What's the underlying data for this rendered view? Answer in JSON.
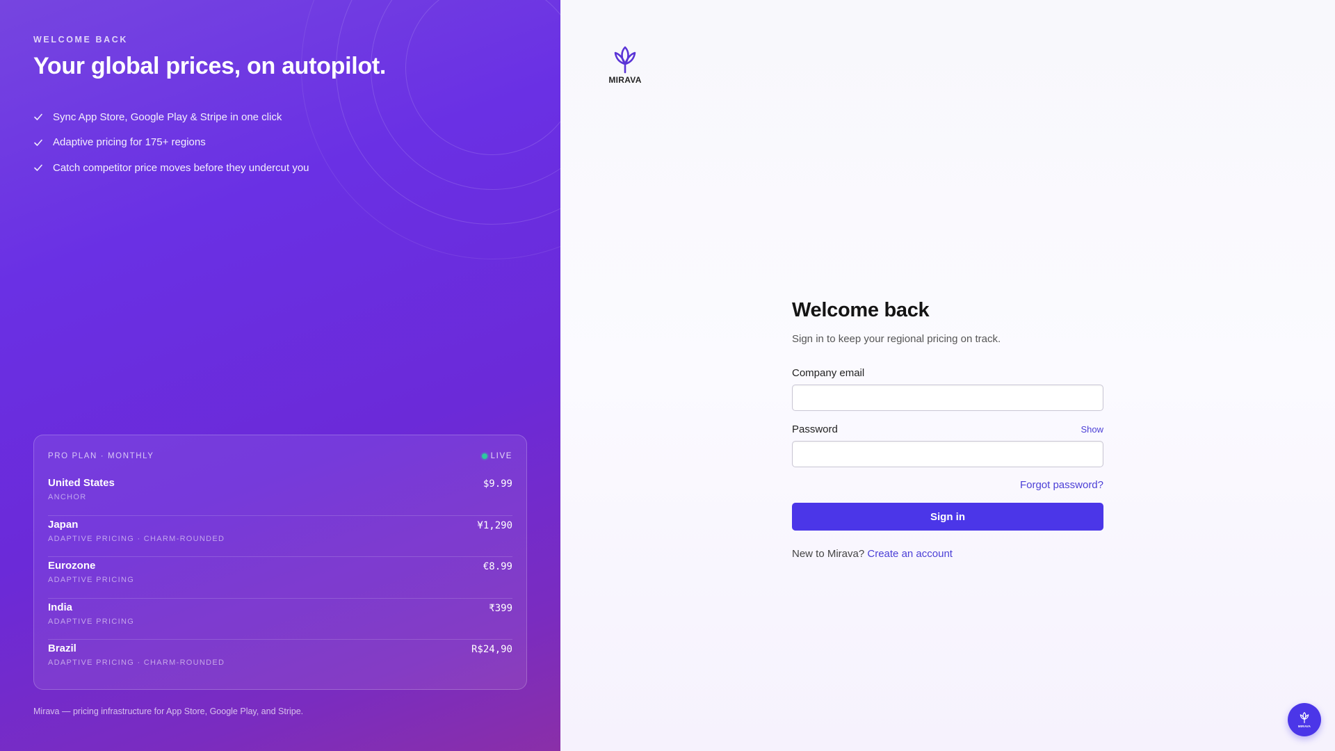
{
  "promo": {
    "eyebrow": "WELCOME BACK",
    "headline": "Your global prices, on autopilot.",
    "features": [
      "Sync App Store, Google Play & Stripe in one click",
      "Adaptive pricing for 175+ regions",
      "Catch competitor price moves before they undercut you"
    ],
    "card": {
      "title": "PRO PLAN · MONTHLY",
      "status": "LIVE",
      "rows": [
        {
          "country": "United States",
          "tags": "ANCHOR",
          "price": "$9.99"
        },
        {
          "country": "Japan",
          "tags": "ADAPTIVE PRICING · CHARM-ROUNDED",
          "price": "¥1,290"
        },
        {
          "country": "Eurozone",
          "tags": "ADAPTIVE PRICING",
          "price": "€8.99"
        },
        {
          "country": "India",
          "tags": "ADAPTIVE PRICING",
          "price": "₹399"
        },
        {
          "country": "Brazil",
          "tags": "ADAPTIVE PRICING · CHARM-ROUNDED",
          "price": "R$24,90"
        }
      ]
    },
    "footer": "Mirava — pricing infrastructure for App Store, Google Play, and Stripe."
  },
  "auth": {
    "logo_text": "MIRAVA",
    "title": "Welcome back",
    "subtitle": "Sign in to keep your regional pricing on track.",
    "email_label": "Company email",
    "email_value": "",
    "password_label": "Password",
    "password_value": "",
    "show_label": "Show",
    "forgot_label": "Forgot password?",
    "signin_label": "Sign in",
    "new_prompt": "New to Mirava?",
    "create_label": "Create an account",
    "fab_text": "MIRAVA"
  },
  "icons": {
    "check": "check-icon",
    "logo": "lotus-logo-icon",
    "live": "live-dot-icon"
  },
  "colors": {
    "accent": "#4b36e8",
    "link": "#4b3fd6",
    "promo_start": "#7645e0",
    "promo_end": "#8a2fa8",
    "live": "#2ec9a0"
  }
}
